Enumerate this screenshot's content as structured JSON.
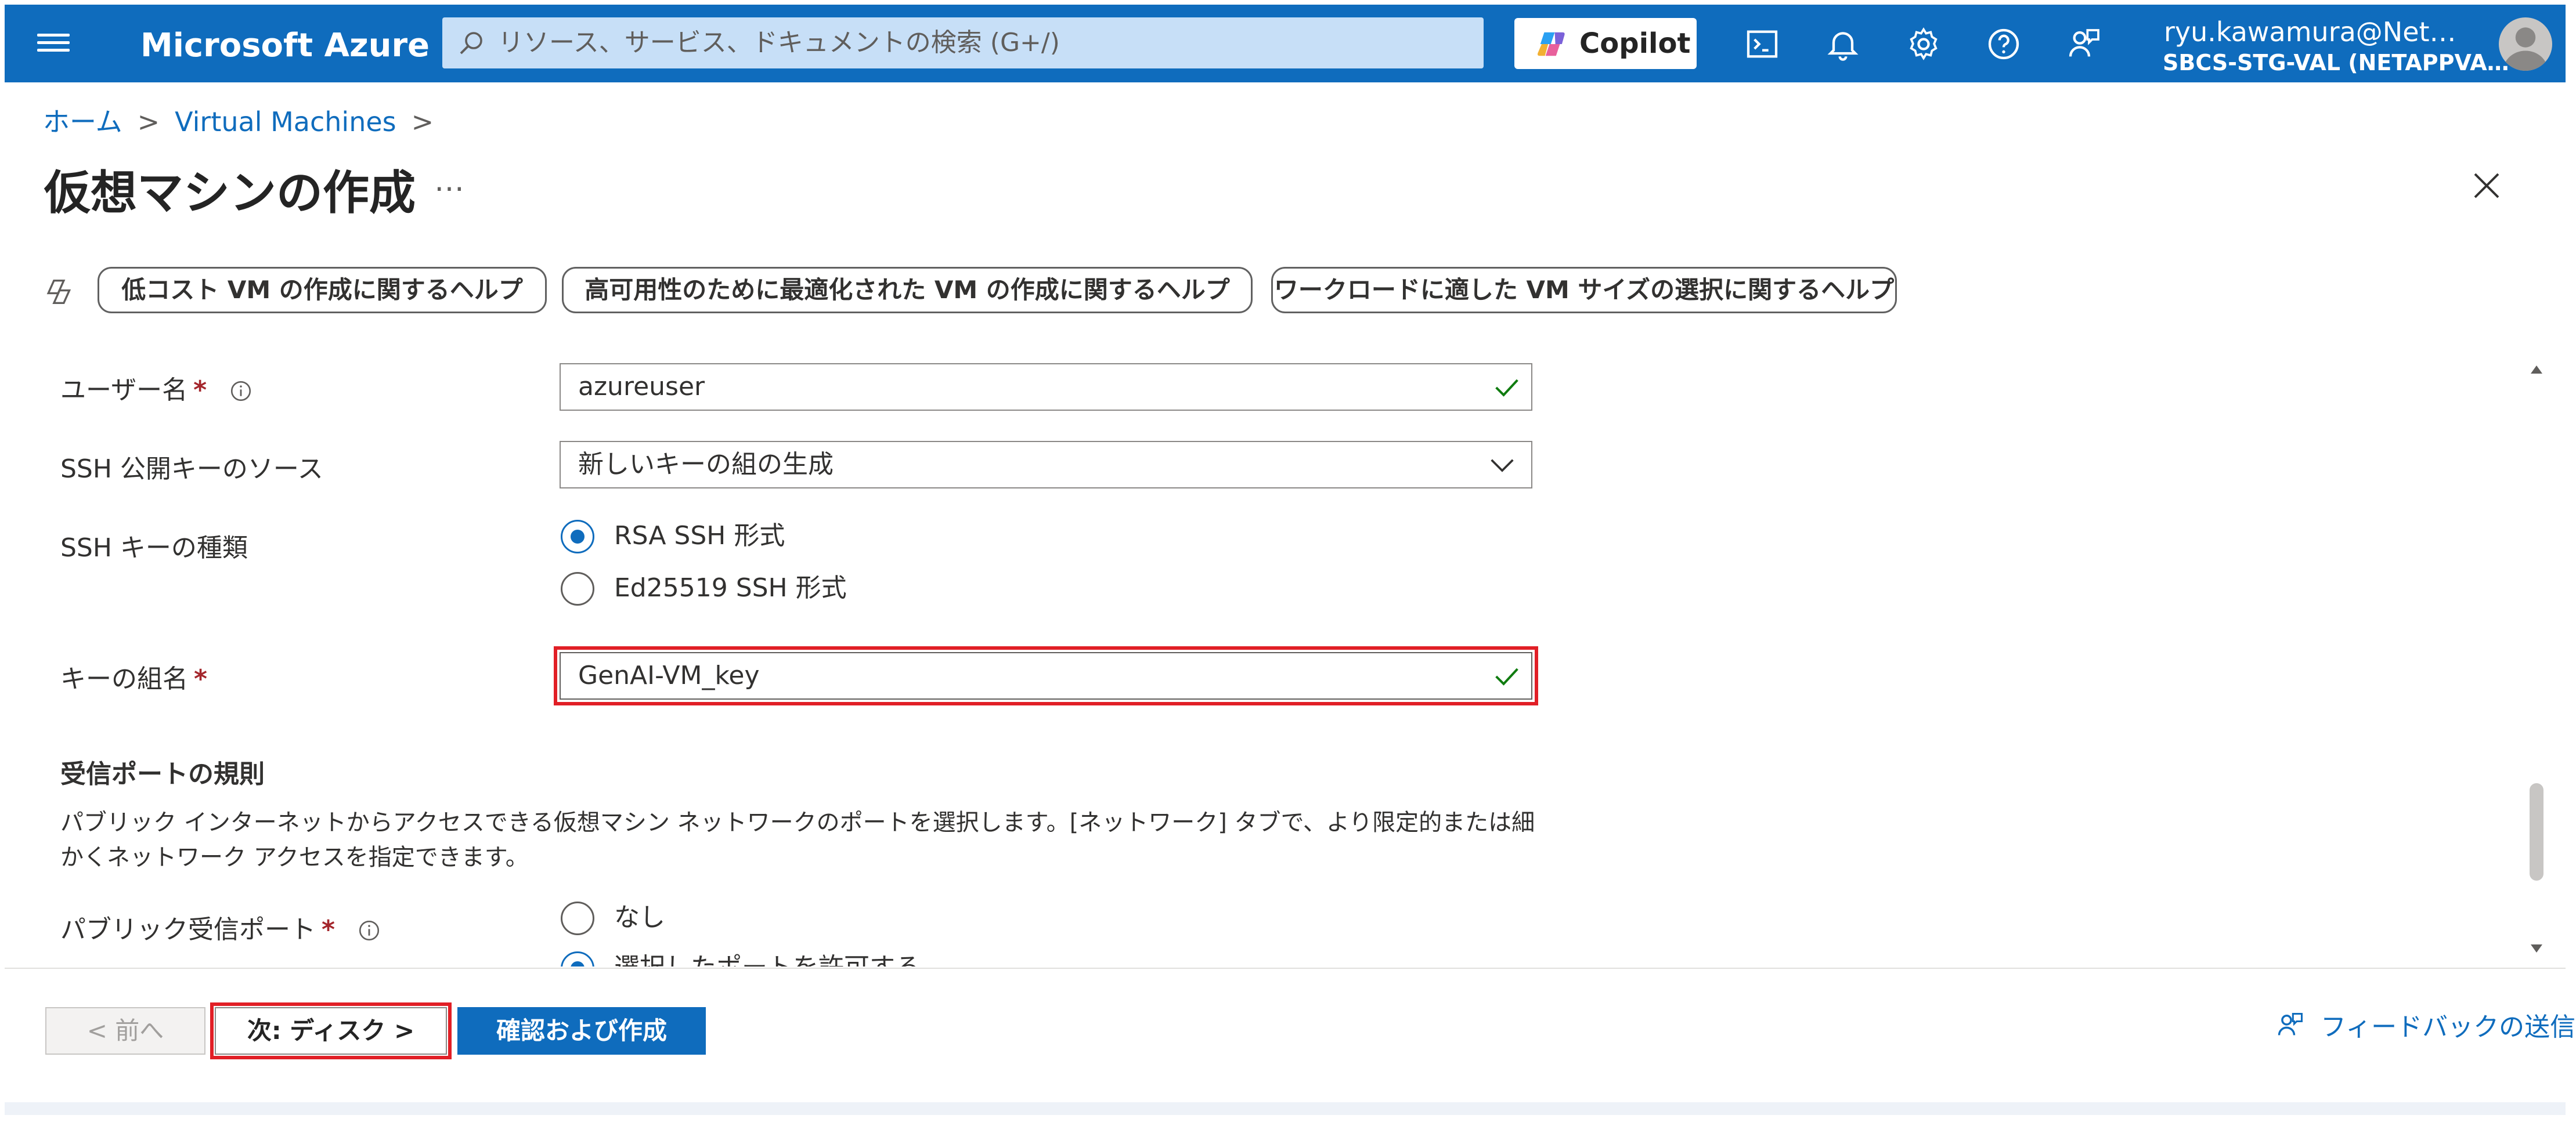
{
  "topbar": {
    "brand": "Microsoft Azure",
    "search_placeholder": "リソース、サービス、ドキュメントの検索 (G+/)",
    "copilot_label": "Copilot",
    "user_name": "ryu.kawamura@Net…",
    "user_tenant": "SBCS-STG-VAL (NETAPPVA…",
    "icons": [
      "cloud-shell-icon",
      "notifications-icon",
      "settings-icon",
      "help-icon",
      "feedback-icon"
    ]
  },
  "breadcrumb": [
    {
      "label": "ホーム"
    },
    {
      "label": "Virtual Machines"
    }
  ],
  "page": {
    "title": "仮想マシンの作成",
    "more_label": "…"
  },
  "help_chips": [
    "低コスト VM の作成に関するヘルプ",
    "高可用性のために最適化された VM の作成に関するヘルプ",
    "ワークロードに適した VM サイズの選択に関するヘルプ"
  ],
  "form": {
    "username": {
      "label": "ユーザー名",
      "required_mark": "*",
      "value": "azureuser"
    },
    "ssh_source": {
      "label": "SSH 公開キーのソース",
      "value": "新しいキーの組の生成"
    },
    "ssh_key_type": {
      "label": "SSH キーの種類",
      "options": [
        {
          "label": "RSA SSH 形式",
          "selected": true
        },
        {
          "label": "Ed25519 SSH 形式",
          "selected": false
        }
      ]
    },
    "key_pair_name": {
      "label": "キーの組名",
      "required_mark": "*",
      "value": "GenAI-VM_key"
    },
    "inbound_rules": {
      "heading": "受信ポートの規則",
      "description": "パブリック インターネットからアクセスできる仮想マシン ネットワークのポートを選択します。[ネットワーク] タブで、より限定的または細かくネットワーク アクセスを指定できます。"
    },
    "public_inbound_ports": {
      "label": "パブリック受信ポート",
      "required_mark": "*",
      "options": [
        {
          "label": "なし",
          "selected": false
        },
        {
          "label": "選択したポートを許可する",
          "selected": true
        }
      ]
    }
  },
  "footer": {
    "prev_label": "< 前へ",
    "next_label": "次: ディスク >",
    "create_label": "確認および作成",
    "feedback_label": "フィードバックの送信"
  },
  "colors": {
    "azure_blue": "#0f6cbd",
    "highlight_red": "#e11f26",
    "valid_green": "#107c10"
  }
}
